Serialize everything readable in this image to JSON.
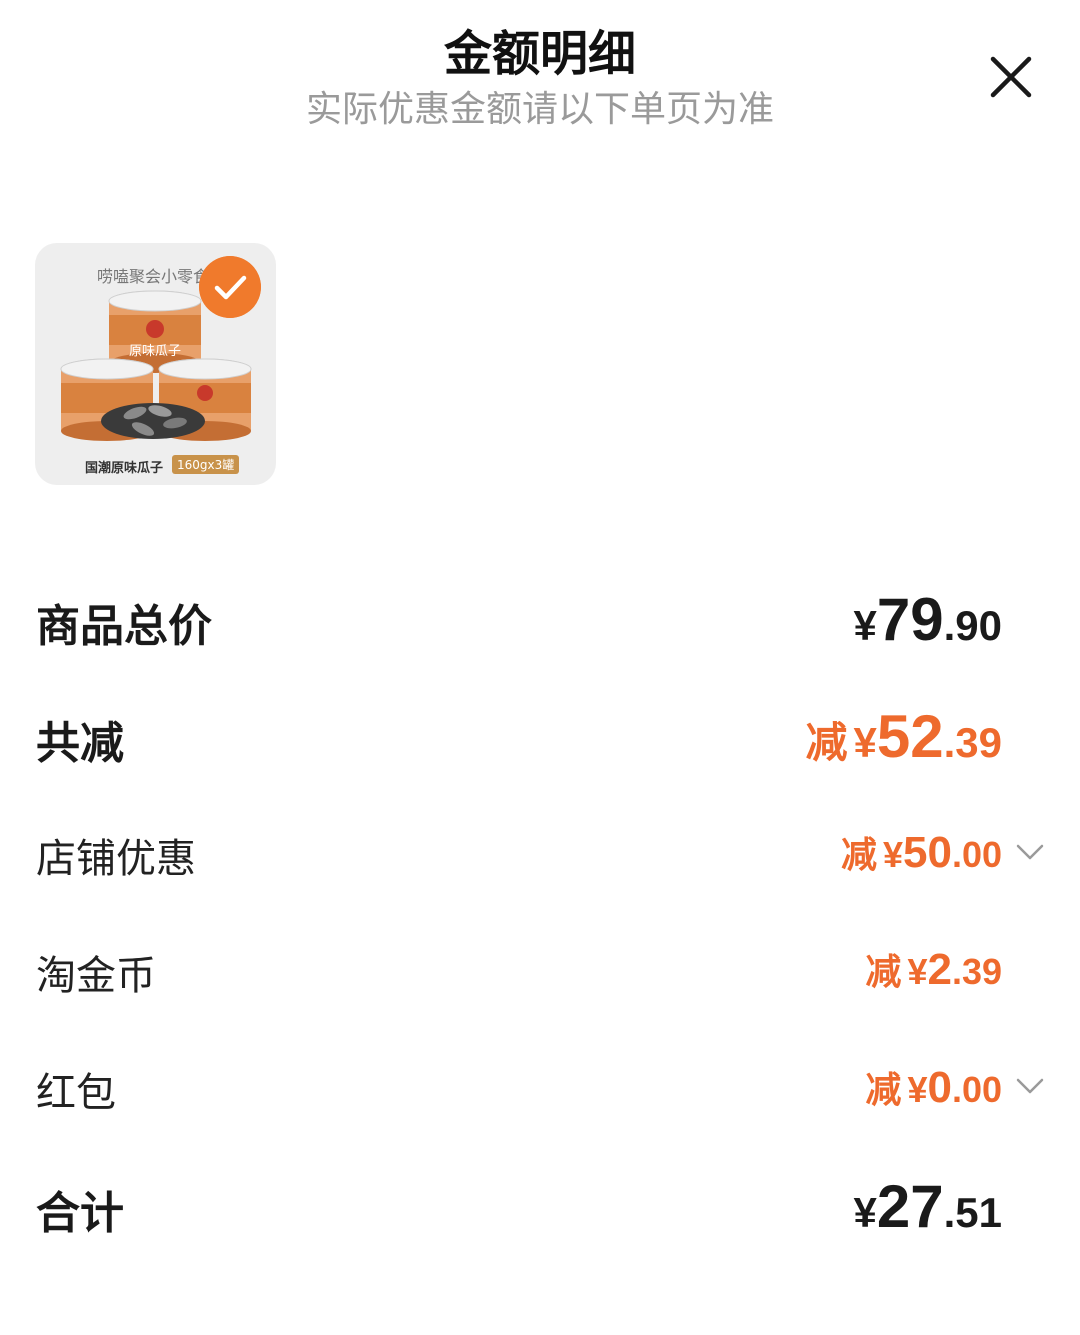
{
  "header": {
    "title": "金额明细",
    "subtitle": "实际优惠金额请以下单页为准"
  },
  "product": {
    "image_top_text": "唠嗑聚会小零食",
    "image_bottom_text": "国潮原味瓜子",
    "image_tag": "160gx3罐",
    "can_label": "原味瓜子",
    "selected": true
  },
  "rows": {
    "total_price": {
      "label": "商品总价",
      "currency": "¥",
      "int": "79",
      "dec": ".90"
    },
    "total_discount": {
      "label": "共减",
      "prefix": "减",
      "currency": "¥",
      "int": "52",
      "dec": ".39"
    },
    "store_discount": {
      "label": "店铺优惠",
      "prefix": "减",
      "currency": "¥",
      "int": "50",
      "dec": ".00"
    },
    "taojin_coin": {
      "label": "淘金币",
      "prefix": "减",
      "currency": "¥",
      "int": "2",
      "dec": ".39"
    },
    "red_packet": {
      "label": "红包",
      "prefix": "减",
      "currency": "¥",
      "int": "0",
      "dec": ".00"
    },
    "grand_total": {
      "label": "合计",
      "currency": "¥",
      "int": "27",
      "dec": ".51"
    }
  },
  "colors": {
    "accent_orange": "#ee6a2d",
    "check_badge": "#f07a2c",
    "subtitle_gray": "#9a9a9a"
  },
  "icons": [
    "close-icon",
    "checkmark-icon",
    "chevron-down-icon"
  ]
}
